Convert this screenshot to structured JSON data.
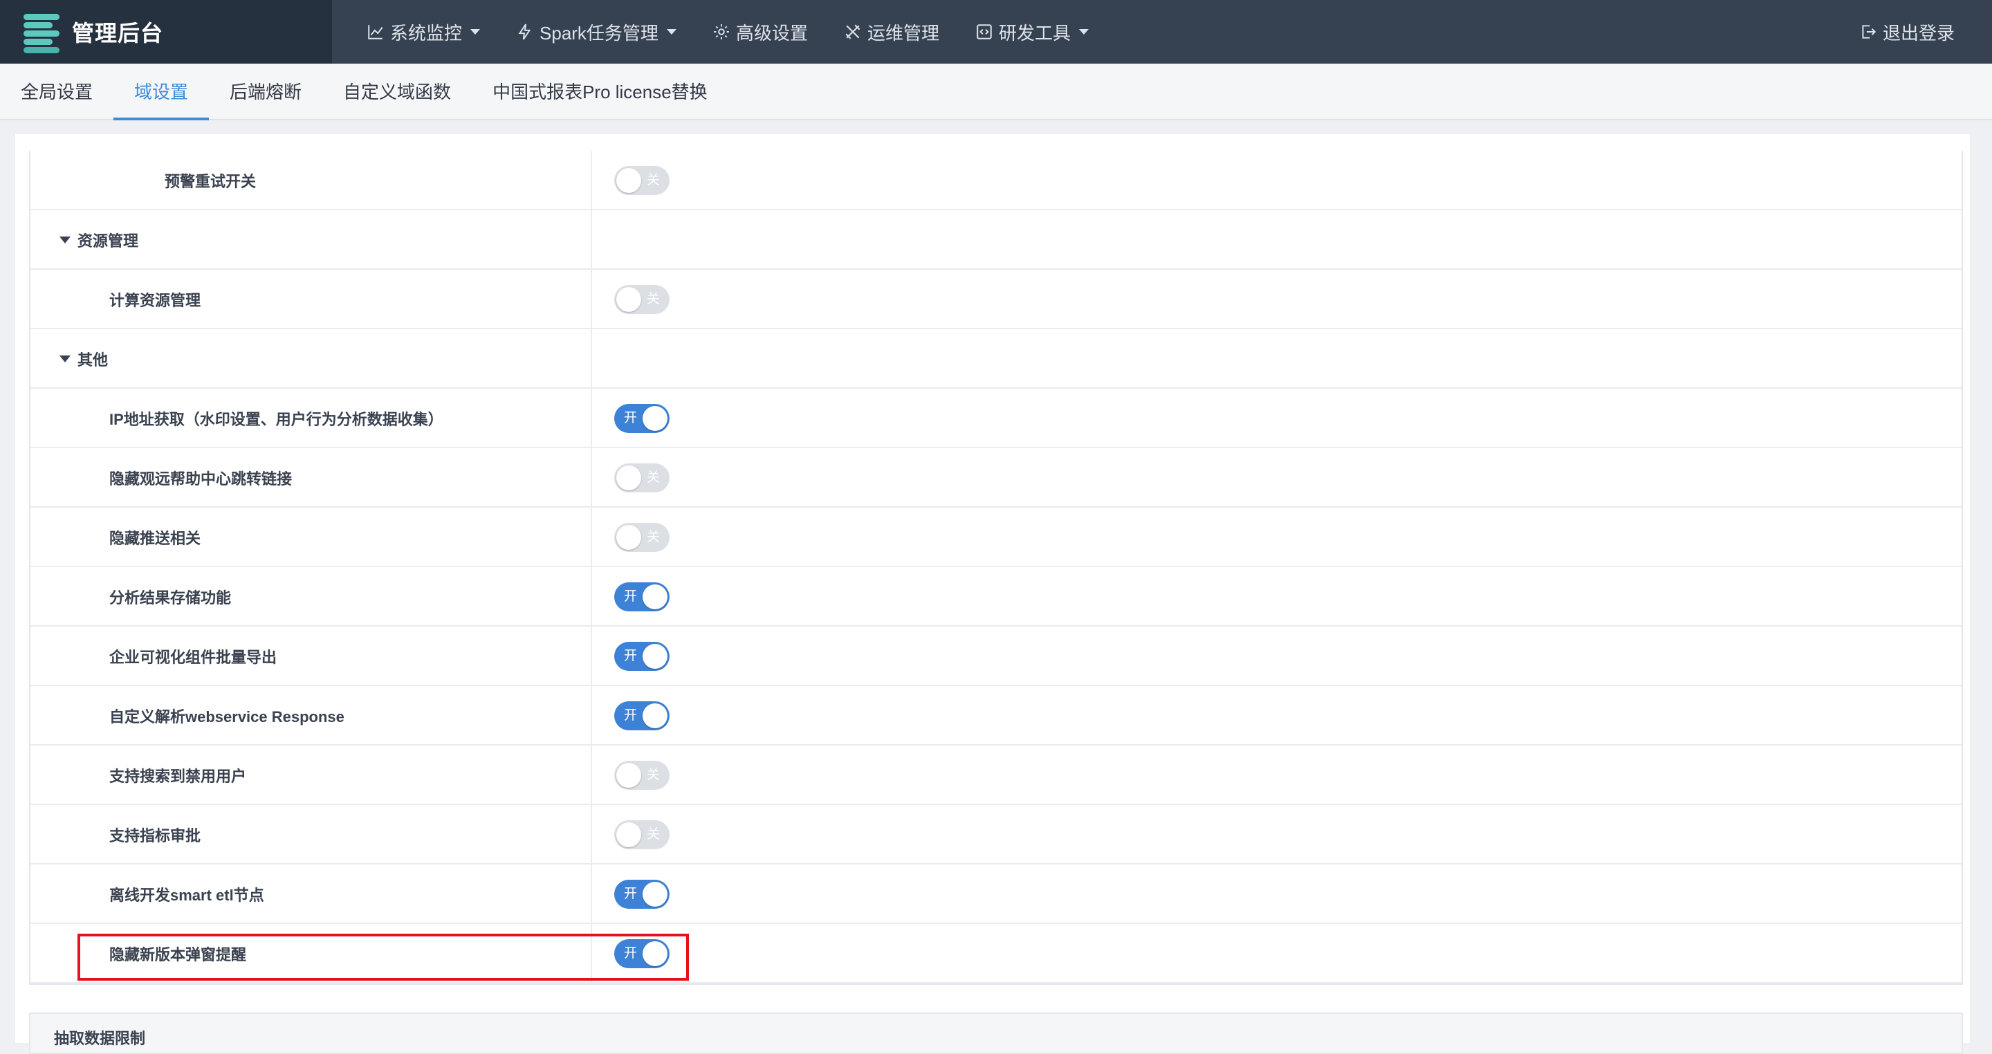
{
  "header": {
    "brand_title": "管理后台",
    "nav": [
      {
        "label": "系统监控",
        "icon": "chart-line-icon",
        "dropdown": true
      },
      {
        "label": "Spark任务管理",
        "icon": "lightning-icon",
        "dropdown": true
      },
      {
        "label": "高级设置",
        "icon": "gear-icon",
        "dropdown": false
      },
      {
        "label": "运维管理",
        "icon": "tools-icon",
        "dropdown": false
      },
      {
        "label": "研发工具",
        "icon": "code-icon",
        "dropdown": true
      }
    ],
    "logout_label": "退出登录"
  },
  "tabs": [
    {
      "label": "全局设置",
      "active": false
    },
    {
      "label": "域设置",
      "active": true
    },
    {
      "label": "后端熔断",
      "active": false
    },
    {
      "label": "自定义域函数",
      "active": false
    },
    {
      "label": "中国式报表Pro license替换",
      "active": false
    }
  ],
  "settings": {
    "rows": [
      {
        "type": "item",
        "indent": 2,
        "label": "预警重试开关",
        "state": "off",
        "switch_text": "关"
      },
      {
        "type": "group",
        "label": "资源管理"
      },
      {
        "type": "item",
        "indent": 1,
        "label": "计算资源管理",
        "state": "off",
        "switch_text": "关"
      },
      {
        "type": "group",
        "label": "其他"
      },
      {
        "type": "item",
        "indent": 1,
        "label": "IP地址获取（水印设置、用户行为分析数据收集）",
        "state": "on",
        "switch_text": "开"
      },
      {
        "type": "item",
        "indent": 1,
        "label": "隐藏观远帮助中心跳转链接",
        "state": "off",
        "switch_text": "关"
      },
      {
        "type": "item",
        "indent": 1,
        "label": "隐藏推送相关",
        "state": "off",
        "switch_text": "关"
      },
      {
        "type": "item",
        "indent": 1,
        "label": "分析结果存储功能",
        "state": "on",
        "switch_text": "开"
      },
      {
        "type": "item",
        "indent": 1,
        "label": "企业可视化组件批量导出",
        "state": "on",
        "switch_text": "开"
      },
      {
        "type": "item",
        "indent": 1,
        "label": "自定义解析webservice Response",
        "state": "on",
        "switch_text": "开"
      },
      {
        "type": "item",
        "indent": 1,
        "label": "支持搜索到禁用用户",
        "state": "off",
        "switch_text": "关"
      },
      {
        "type": "item",
        "indent": 1,
        "label": "支持指标审批",
        "state": "off",
        "switch_text": "关"
      },
      {
        "type": "item",
        "indent": 1,
        "label": "离线开发smart etl节点",
        "state": "on",
        "switch_text": "开"
      },
      {
        "type": "item",
        "indent": 1,
        "label": "隐藏新版本弹窗提醒",
        "state": "on",
        "switch_text": "开",
        "highlighted": true
      }
    ]
  },
  "extract_section": {
    "title": "抽取数据限制"
  },
  "colors": {
    "header_bg": "#364152",
    "brand_bg": "#263140",
    "accent": "#3d82d6",
    "highlight": "#e3121c"
  }
}
